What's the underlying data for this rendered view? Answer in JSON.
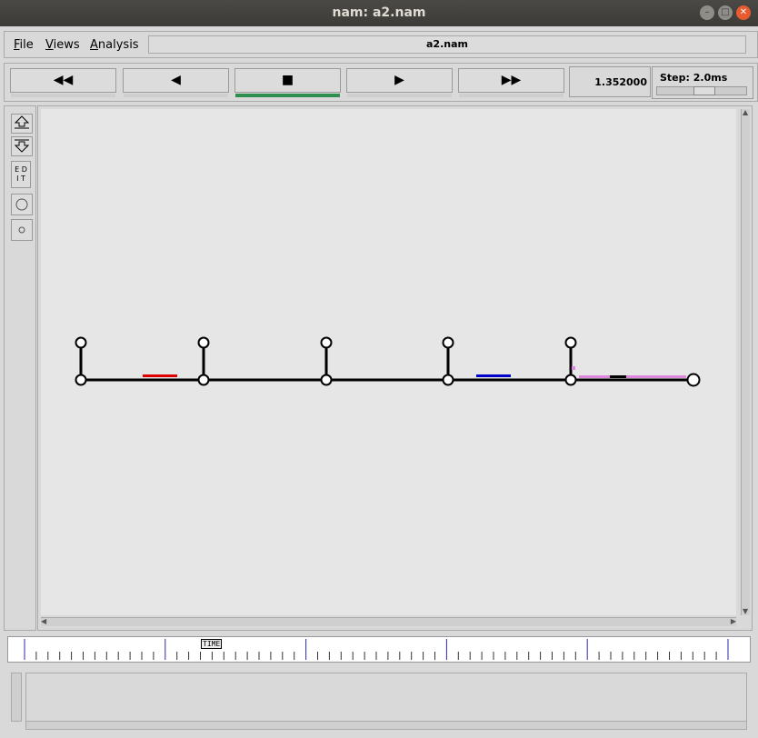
{
  "window": {
    "title": "nam: a2.nam"
  },
  "menu": {
    "items": [
      {
        "label": "File",
        "mnemonic": "F",
        "rest": "ile"
      },
      {
        "label": "Views",
        "mnemonic": "V",
        "rest": "iews"
      },
      {
        "label": "Analysis",
        "mnemonic": "A",
        "rest": "nalysis"
      }
    ],
    "filename": "a2.nam"
  },
  "playback": {
    "rewind": "◀◀",
    "back": "◀",
    "stop": "■",
    "play": "▶",
    "fast_forward": "▶▶",
    "time": "1.352000",
    "step_label": "Step: 2.0ms"
  },
  "sidebar": {
    "edit_label_1": "E D",
    "edit_label_2": "I T"
  },
  "network": {
    "packet_colors": {
      "red": "#e00000",
      "blue": "#0000cc",
      "pink": "#dd88dd",
      "black": "#000000"
    }
  },
  "timeline": {
    "marker": "TIME"
  }
}
